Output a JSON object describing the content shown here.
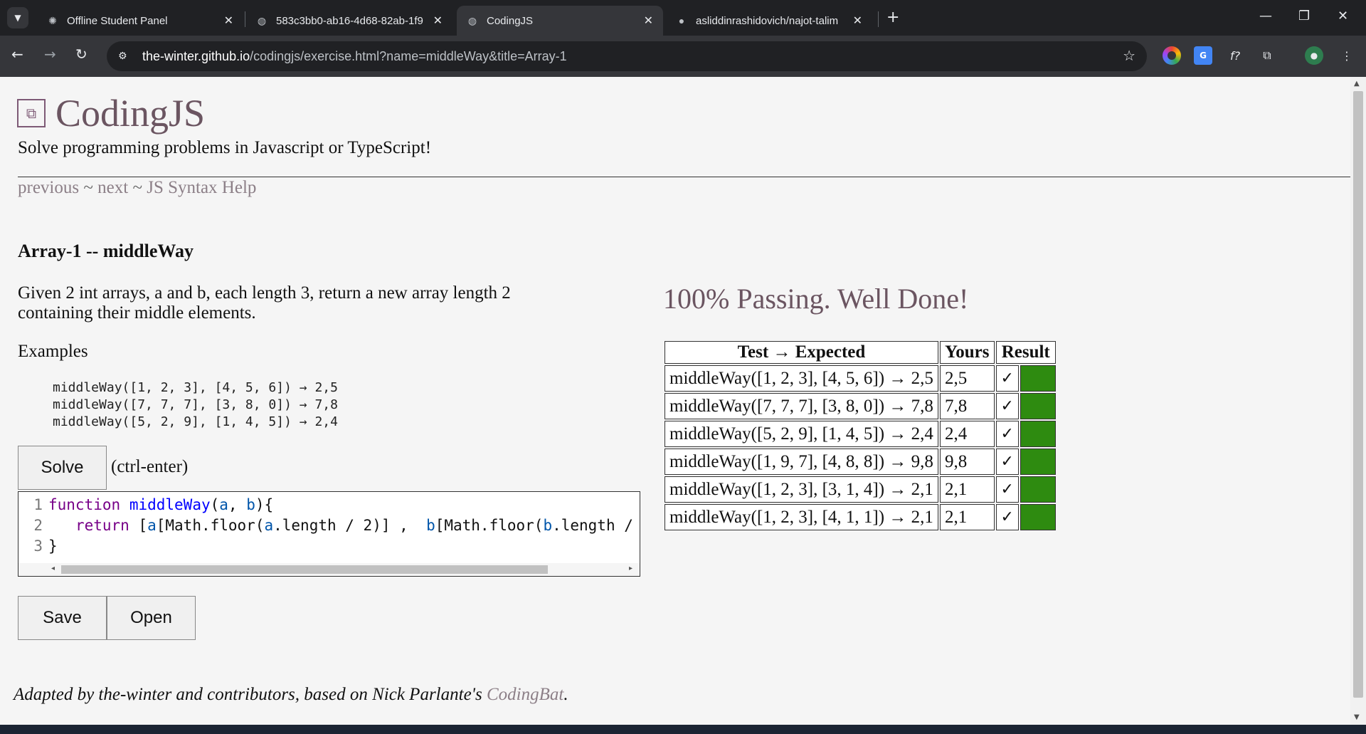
{
  "browser": {
    "tabs": [
      {
        "title": "Offline Student Panel",
        "icon": "orb-icon"
      },
      {
        "title": "583c3bb0-ab16-4d68-82ab-1f9",
        "icon": "globe-icon"
      },
      {
        "title": "CodingJS",
        "icon": "globe-icon",
        "active": true
      },
      {
        "title": "asliddinrashidovich/najot-talim",
        "icon": "github-icon"
      }
    ],
    "url_host": "the-winter.github.io",
    "url_path": "/codingjs/exercise.html?name=middleWay&title=Array-1"
  },
  "page": {
    "site_title": "CodingJS",
    "tagline": "Solve programming problems in Javascript or TypeScript!",
    "nav": {
      "previous": "previous",
      "next": "next",
      "help": "JS Syntax Help",
      "sep": "~"
    },
    "exercise_title": "Array-1 -- middleWay",
    "description": "Given 2 int arrays, a and b, each length 3, return a new array length 2 containing their middle elements.",
    "examples_label": "Examples",
    "examples": [
      "middleWay([1, 2, 3], [4, 5, 6]) → 2,5",
      "middleWay([7, 7, 7], [3, 8, 0]) → 7,8",
      "middleWay([5, 2, 9], [1, 4, 5]) → 2,4"
    ],
    "solve_label": "Solve",
    "solve_hint": "(ctrl-enter)",
    "save_label": "Save",
    "open_label": "Open",
    "pass_message": "100% Passing. Well Done!",
    "results_headers": {
      "test": "Test → Expected",
      "yours": "Yours",
      "result": "Result"
    },
    "results": [
      {
        "test": "middleWay([1, 2, 3], [4, 5, 6]) → 2,5",
        "yours": "2,5",
        "mark": "✓"
      },
      {
        "test": "middleWay([7, 7, 7], [3, 8, 0]) → 7,8",
        "yours": "7,8",
        "mark": "✓"
      },
      {
        "test": "middleWay([5, 2, 9], [1, 4, 5]) → 2,4",
        "yours": "2,4",
        "mark": "✓"
      },
      {
        "test": "middleWay([1, 9, 7], [4, 8, 8]) → 9,8",
        "yours": "9,8",
        "mark": "✓"
      },
      {
        "test": "middleWay([1, 2, 3], [3, 1, 4]) → 2,1",
        "yours": "2,1",
        "mark": "✓"
      },
      {
        "test": "middleWay([1, 2, 3], [4, 1, 1]) → 2,1",
        "yours": "2,1",
        "mark": "✓"
      }
    ],
    "pass_color": "#2e8b10",
    "footer_text": "Adapted by the-winter and contributors, based on Nick Parlante's",
    "footer_link": "CodingBat",
    "footer_end": "."
  }
}
